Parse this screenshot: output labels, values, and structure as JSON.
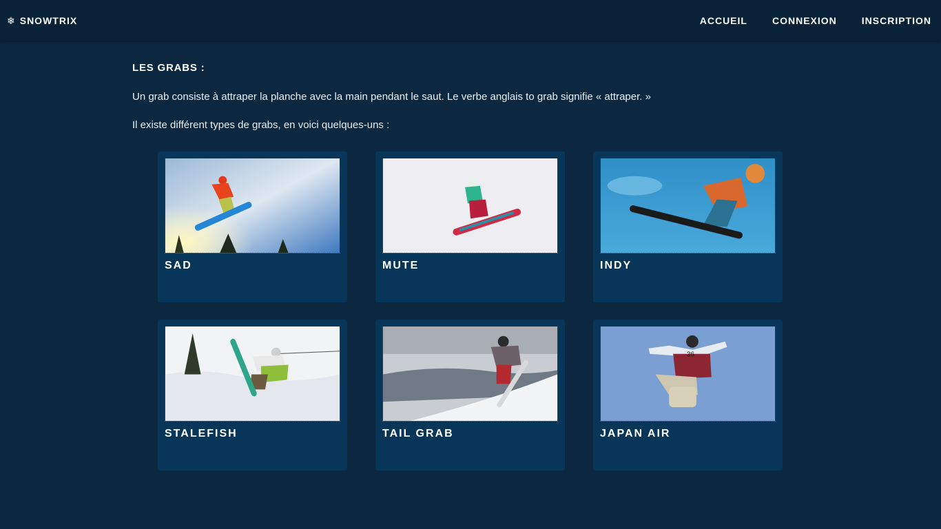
{
  "brand": {
    "icon": "snowflake-icon",
    "name": "SNOWTRIX"
  },
  "nav": {
    "home": "ACCUEIL",
    "login": "CONNEXION",
    "signup": "INSCRIPTION"
  },
  "section": {
    "title": "LES GRABS :",
    "intro": "Un grab consiste à attraper la planche avec la main pendant le saut. Le verbe anglais to grab signifie « attraper. »",
    "list_intro": "Il existe différent types de grabs, en voici quelques-uns :"
  },
  "tricks": [
    {
      "name": "SAD"
    },
    {
      "name": "MUTE"
    },
    {
      "name": "INDY"
    },
    {
      "name": "STALEFISH"
    },
    {
      "name": "TAIL GRAB"
    },
    {
      "name": "JAPAN AIR"
    }
  ],
  "colors": {
    "background": "#0b2840",
    "navbar": "#0a2238",
    "card": "#083658",
    "text": "#ffffff"
  }
}
